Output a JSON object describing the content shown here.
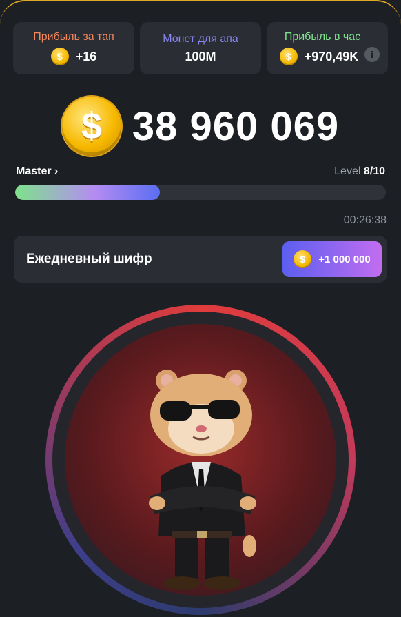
{
  "stats": [
    {
      "label": "Прибыль за тап",
      "value": "+16",
      "color": "#f2855a",
      "has_coin": true,
      "has_info": false
    },
    {
      "label": "Монет для апа",
      "value": "100M",
      "color": "#8a85f0",
      "has_coin": false,
      "has_info": false
    },
    {
      "label": "Прибыль в час",
      "value": "+970,49K",
      "color": "#7fe28c",
      "has_coin": true,
      "has_info": true
    }
  ],
  "info_glyph": "i",
  "coin_glyph": "$",
  "balance": "38 960 069",
  "level": {
    "name": "Master",
    "chevron": "›",
    "prefix": "Level",
    "value": "8/10",
    "progress": 0.39
  },
  "timer": "00:26:38",
  "cipher": {
    "title": "Ежедневный шифр",
    "reward": "+1 000 000"
  },
  "colors": {
    "accent": "#e0a928",
    "progress_start": "#7fe28c",
    "progress_end": "#5a6ef2",
    "cipher_btn_start": "#5b5ff0",
    "cipher_btn_end": "#c26df0"
  },
  "mascot": "hamster-in-suit-with-sunglasses"
}
